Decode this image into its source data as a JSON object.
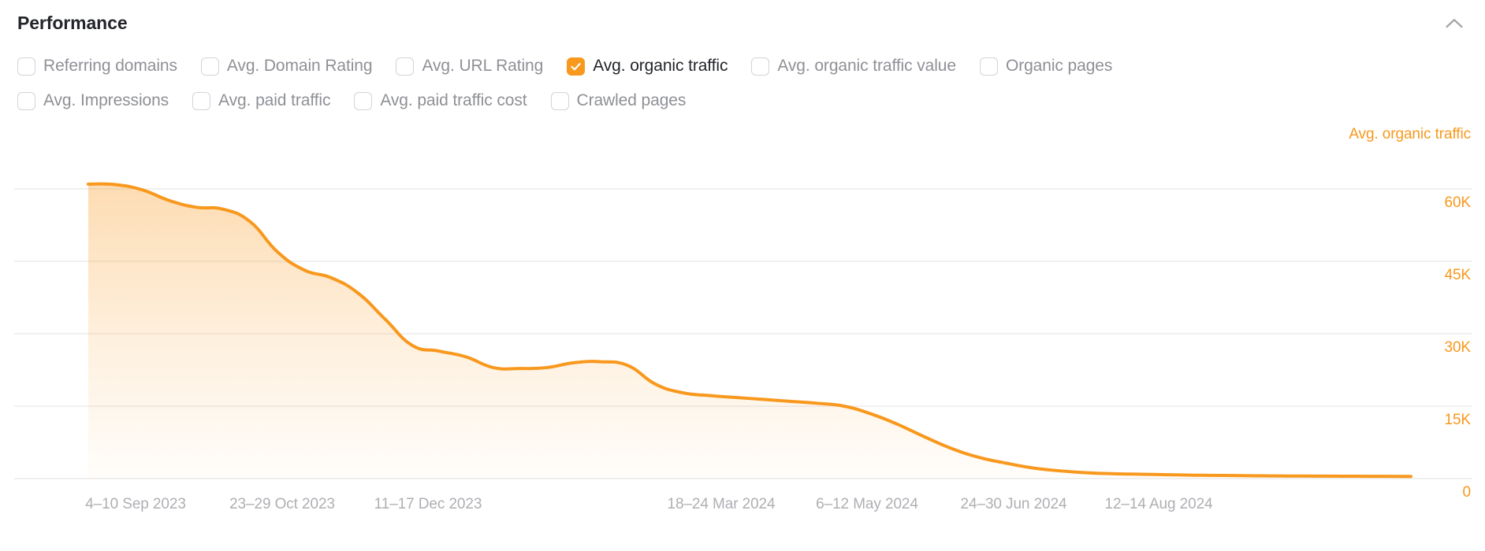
{
  "header": {
    "title": "Performance",
    "collapse_icon": "chevron-up-icon"
  },
  "metrics": {
    "rows": [
      [
        {
          "label": "Referring domains",
          "checked": false
        },
        {
          "label": "Avg. Domain Rating",
          "checked": false
        },
        {
          "label": "Avg. URL Rating",
          "checked": false
        },
        {
          "label": "Avg. organic traffic",
          "checked": true
        },
        {
          "label": "Avg. organic traffic value",
          "checked": false
        },
        {
          "label": "Organic pages",
          "checked": false
        }
      ],
      [
        {
          "label": "Avg. Impressions",
          "checked": false
        },
        {
          "label": "Avg. paid traffic",
          "checked": false
        },
        {
          "label": "Avg. paid traffic cost",
          "checked": false
        },
        {
          "label": "Crawled pages",
          "checked": false
        }
      ]
    ]
  },
  "colors": {
    "accent": "#f8981d",
    "area_top": "#fbd6ac",
    "gridline": "#ececec",
    "label_muted": "#8f9096",
    "label_dark": "#23252a"
  },
  "chart_data": {
    "type": "area",
    "title": "Avg. organic traffic",
    "series_name": "Avg. organic traffic",
    "xlabel": "",
    "ylabel": "Avg. organic traffic",
    "ylim": [
      0,
      60000
    ],
    "yticks": [
      60000,
      45000,
      30000,
      15000,
      0
    ],
    "ytick_labels": [
      "60K",
      "45K",
      "30K",
      "15K",
      "0"
    ],
    "grid": true,
    "legend_position": "top-right",
    "xtick_labels": [
      "4–10 Sep 2023",
      "23–29 Oct 2023",
      "11–17 Dec 2023",
      "18–24 Mar 2024",
      "6–12 May 2024",
      "24–30 Jun 2024",
      "12–14 Aug 2024"
    ],
    "xtick_positions": [
      172,
      358,
      543,
      915,
      1100,
      1286,
      1470
    ],
    "x": [
      "4–10 Sep 2023",
      "11–17 Sep 2023",
      "18–24 Sep 2023",
      "25 Sep–1 Oct 2023",
      "2–8 Oct 2023",
      "9–15 Oct 2023",
      "16–22 Oct 2023",
      "23–29 Oct 2023",
      "30 Oct–5 Nov 2023",
      "6–12 Nov 2023",
      "13–19 Nov 2023",
      "20–26 Nov 2023",
      "27 Nov–3 Dec 2023",
      "4–10 Dec 2023",
      "11–17 Dec 2023",
      "18–24 Dec 2023",
      "25–31 Dec 2023",
      "1–7 Jan 2024",
      "8–14 Jan 2024",
      "15–21 Jan 2024",
      "22–28 Jan 2024",
      "29 Jan–4 Feb 2024",
      "5–11 Feb 2024",
      "12–18 Feb 2024",
      "19–25 Feb 2024",
      "26 Feb–3 Mar 2024",
      "4–10 Mar 2024",
      "11–17 Mar 2024",
      "18–24 Mar 2024",
      "25–31 Mar 2024",
      "1–7 Apr 2024",
      "8–14 Apr 2024",
      "15–21 Apr 2024",
      "22–28 Apr 2024",
      "29 Apr–5 May 2024",
      "6–12 May 2024",
      "13–19 May 2024",
      "20–26 May 2024",
      "27 May–2 Jun 2024",
      "3–9 Jun 2024",
      "10–16 Jun 2024",
      "17–23 Jun 2024",
      "24–30 Jun 2024",
      "1–7 Jul 2024",
      "8–14 Jul 2024",
      "15–21 Jul 2024",
      "22–28 Jul 2024",
      "29 Jul–4 Aug 2024",
      "5–11 Aug 2024",
      "12–14 Aug 2024"
    ],
    "values": [
      61000,
      60900,
      59800,
      57600,
      56200,
      55800,
      53200,
      47000,
      43200,
      41600,
      38400,
      33000,
      27600,
      26400,
      25200,
      23000,
      22800,
      23000,
      24000,
      24200,
      23400,
      19600,
      17800,
      17200,
      16800,
      16400,
      16000,
      15600,
      15000,
      13400,
      11200,
      8600,
      6200,
      4400,
      3200,
      2200,
      1600,
      1200,
      1000,
      900,
      800,
      700,
      650,
      600,
      560,
      520,
      500,
      480,
      460,
      440
    ]
  }
}
